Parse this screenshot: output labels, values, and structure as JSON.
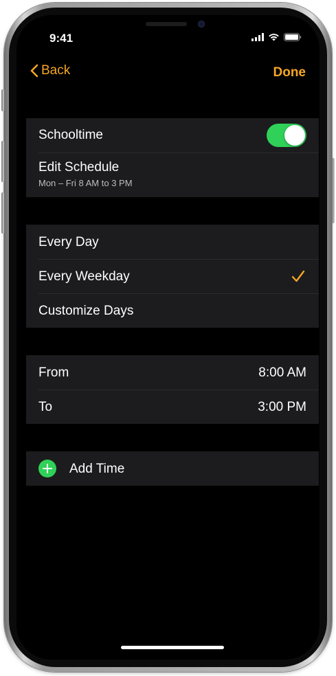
{
  "status_bar": {
    "time": "9:41"
  },
  "nav": {
    "back_label": "Back",
    "done_label": "Done",
    "accent_color": "#f5a623"
  },
  "schooltime": {
    "label": "Schooltime",
    "enabled": true,
    "toggle_color": "#30d158",
    "edit_schedule_label": "Edit Schedule",
    "edit_schedule_subtitle": "Mon – Fri 8 AM to 3 PM"
  },
  "repeat_options": [
    {
      "label": "Every Day",
      "selected": false
    },
    {
      "label": "Every Weekday",
      "selected": true
    },
    {
      "label": "Customize Days",
      "selected": false
    }
  ],
  "time_range": {
    "from_label": "From",
    "from_value": "8:00 AM",
    "to_label": "To",
    "to_value": "3:00 PM"
  },
  "add_time": {
    "label": "Add Time",
    "icon": "plus-circle-icon",
    "icon_color": "#30d158"
  }
}
